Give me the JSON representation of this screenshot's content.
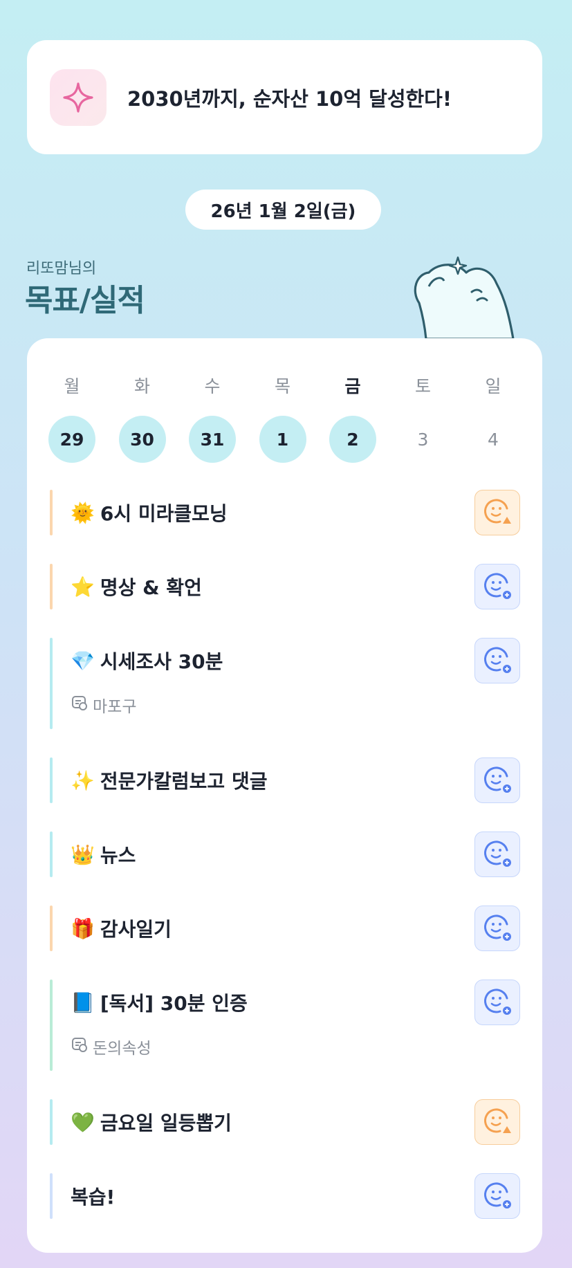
{
  "goal": {
    "text": "2030년까지, 순자산 10억 달성한다!",
    "icon": "sparkle-icon"
  },
  "date": "26년 1월 2일(금)",
  "section": {
    "owner": "리또맘님의",
    "title": "목표/실적"
  },
  "week": [
    {
      "day": "월",
      "num": "29",
      "state": "done"
    },
    {
      "day": "화",
      "num": "30",
      "state": "done"
    },
    {
      "day": "수",
      "num": "31",
      "state": "done"
    },
    {
      "day": "목",
      "num": "1",
      "state": "done"
    },
    {
      "day": "금",
      "num": "2",
      "state": "today"
    },
    {
      "day": "토",
      "num": "3",
      "state": "future"
    },
    {
      "day": "일",
      "num": "4",
      "state": "future"
    }
  ],
  "tasks": [
    {
      "emoji": "🌞",
      "title": "6시 미라클모닝",
      "status": "pending"
    },
    {
      "emoji": "⭐",
      "title": "명상 & 확언",
      "status": "add"
    },
    {
      "emoji": "💎",
      "title": "시세조사 30분",
      "sub": "마포구",
      "status": "add"
    },
    {
      "emoji": "✨",
      "title": "전문가칼럼보고 댓글",
      "status": "add"
    },
    {
      "emoji": "👑",
      "title": "뉴스",
      "status": "add"
    },
    {
      "emoji": "🎁",
      "title": "감사일기",
      "status": "add"
    },
    {
      "emoji": "📘",
      "title": "[독서] 30분 인증",
      "sub": "돈의속성",
      "status": "add"
    },
    {
      "emoji": "💚",
      "title": "금요일 일등뽑기",
      "status": "pending"
    },
    {
      "emoji": "",
      "title": "복습!",
      "status": "add"
    }
  ],
  "colors": {
    "pending": "#f5a150",
    "add": "#5680ef",
    "bar_orange": "#fbd6ae",
    "bar_teal": "#b5ebf0",
    "bar_green": "#b9ecd6",
    "bar_blue": "#cfe0fb"
  }
}
